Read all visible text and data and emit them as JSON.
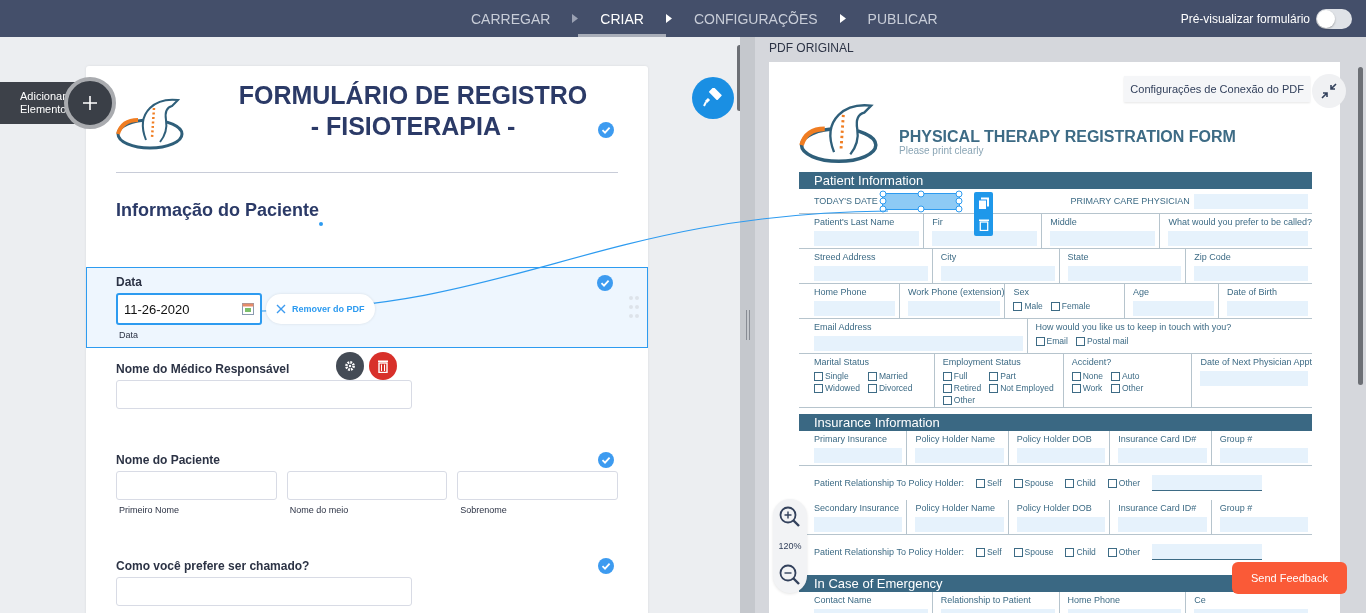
{
  "topbar": {
    "steps": [
      {
        "label": "CARREGAR",
        "selected": false
      },
      {
        "label": "CRIAR",
        "selected": true
      },
      {
        "label": "CONFIGURAÇÕES",
        "selected": false
      },
      {
        "label": "PUBLICAR",
        "selected": false
      }
    ],
    "preview": {
      "label": "Pré-visualizar formulário",
      "on": false
    }
  },
  "add_element": {
    "label": "Adicionar Elemento"
  },
  "form": {
    "title_lines": [
      "FORMULÁRIO DE REGISTRO",
      "- FISIOTERAPIA -"
    ],
    "title_verified": true,
    "section_heading": "Informação do Paciente",
    "fields": [
      {
        "kind": "date",
        "label": "Data",
        "value": "11-26-2020",
        "sublabel": "Data",
        "selected": true,
        "verified": true,
        "remove_label": "Remover do PDF"
      },
      {
        "kind": "text",
        "label": "Nome do Médico Responsável",
        "selected": false,
        "verified": false
      },
      {
        "kind": "name",
        "label": "Nome do Paciente",
        "selected": false,
        "verified": true,
        "parts": [
          "Primeiro Nome",
          "Nome do meio",
          "Sobrenome"
        ]
      },
      {
        "kind": "text",
        "label": "Como você prefere ser chamado?",
        "selected": false,
        "verified": true
      }
    ]
  },
  "pdf_panel": {
    "heading": "PDF ORIGINAL",
    "connection_settings": "Configurações de Conexão do PDF",
    "zoom": "120%",
    "feedback": "Send Feedback",
    "document": {
      "title": "PHYSICAL THERAPY REGISTRATION FORM",
      "subtitle": "Please print clearly",
      "sections": [
        {
          "title": "Patient Information",
          "rows": [
            {
              "kind": "inline",
              "cells": [
                {
                  "label": "TODAY'S DATE",
                  "mapped": true
                },
                {
                  "label": "PRIMARY CARE PHYSICIAN",
                  "mapped": false
                }
              ]
            },
            {
              "kind": "fields",
              "cells": [
                {
                  "label": "Patient's Last Name"
                },
                {
                  "label": "Fir"
                },
                {
                  "label": "Middle"
                },
                {
                  "label": "What would you prefer to be called?"
                }
              ]
            },
            {
              "kind": "fields",
              "cells": [
                {
                  "label": "Streed Address"
                },
                {
                  "label": "City"
                },
                {
                  "label": "State"
                },
                {
                  "label": "Zip Code"
                }
              ]
            },
            {
              "kind": "fields",
              "cells": [
                {
                  "label": "Home Phone"
                },
                {
                  "label": "Work Phone (extension)"
                },
                {
                  "label": "Sex",
                  "options": [
                    "Male",
                    "Female"
                  ]
                },
                {
                  "label": "Age"
                },
                {
                  "label": "Date of Birth"
                }
              ]
            },
            {
              "kind": "fields",
              "cells": [
                {
                  "label": "Email Address"
                },
                {
                  "label": "How would you like us to keep in touch with you?",
                  "options": [
                    "Email",
                    "Postal mail"
                  ]
                }
              ]
            },
            {
              "kind": "fields",
              "cells": [
                {
                  "label": "Marital Status",
                  "options": [
                    "Single",
                    "Married",
                    "Widowed",
                    "Divorced"
                  ]
                },
                {
                  "label": "Employment Status",
                  "options": [
                    "Full",
                    "Part",
                    "Retired",
                    "Not Employed",
                    "Other"
                  ]
                },
                {
                  "label": "Accident?",
                  "options": [
                    "None",
                    "Auto",
                    "Work",
                    "Other"
                  ]
                },
                {
                  "label": "Date of Next Physician Appt"
                }
              ]
            }
          ]
        },
        {
          "title": "Insurance Information",
          "rows": [
            {
              "kind": "fields",
              "cells": [
                {
                  "label": "Primary Insurance"
                },
                {
                  "label": "Policy Holder Name"
                },
                {
                  "label": "Policy Holder DOB"
                },
                {
                  "label": "Insurance Card ID#"
                },
                {
                  "label": "Group #"
                }
              ]
            },
            {
              "kind": "relation",
              "label": "Patient Relationship To Policy Holder:",
              "options": [
                "Self",
                "Spouse",
                "Child",
                "Other"
              ]
            },
            {
              "kind": "fields",
              "cells": [
                {
                  "label": "Secondary Insurance"
                },
                {
                  "label": "Policy Holder Name"
                },
                {
                  "label": "Policy Holder DOB"
                },
                {
                  "label": "Insurance Card ID#"
                },
                {
                  "label": "Group #"
                }
              ]
            },
            {
              "kind": "relation",
              "label": "Patient Relationship To Policy Holder:",
              "options": [
                "Self",
                "Spouse",
                "Child",
                "Other"
              ]
            }
          ]
        },
        {
          "title": "In Case of Emergency",
          "rows": [
            {
              "kind": "fields",
              "cells": [
                {
                  "label": "Contact Name"
                },
                {
                  "label": "Relationship to Patient"
                },
                {
                  "label": "Home Phone"
                },
                {
                  "label": "Ce"
                }
              ]
            }
          ]
        }
      ]
    }
  }
}
